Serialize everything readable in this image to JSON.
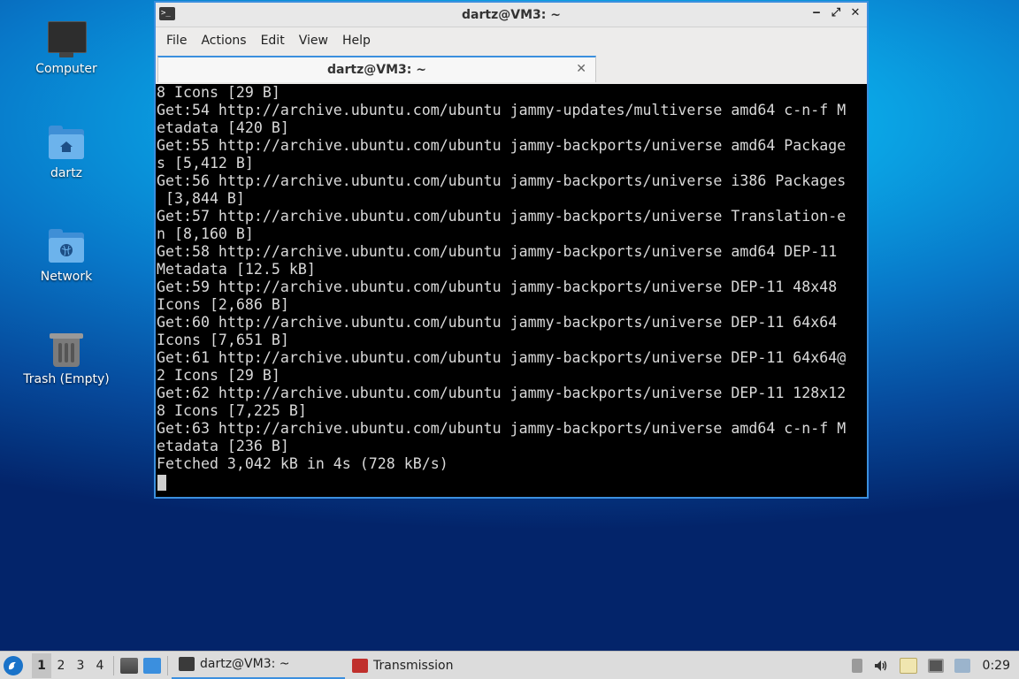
{
  "desktop": {
    "icons": [
      {
        "label": "Computer",
        "icon": "computer-icon"
      },
      {
        "label": "dartz",
        "icon": "home-folder-icon"
      },
      {
        "label": "Network",
        "icon": "network-folder-icon"
      },
      {
        "label": "Trash (Empty)",
        "icon": "trash-icon"
      }
    ]
  },
  "window": {
    "title": "dartz@VM3: ~",
    "controls": {
      "minimize": "‒",
      "maximize": "⤢",
      "close": "✕"
    },
    "menu": [
      "File",
      "Actions",
      "Edit",
      "View",
      "Help"
    ],
    "tab": {
      "label": "dartz@VM3: ~",
      "close": "✕"
    }
  },
  "terminal": {
    "lines": [
      "8 Icons [29 B]",
      "Get:54 http://archive.ubuntu.com/ubuntu jammy-updates/multiverse amd64 c-n-f M",
      "etadata [420 B]",
      "Get:55 http://archive.ubuntu.com/ubuntu jammy-backports/universe amd64 Package",
      "s [5,412 B]",
      "Get:56 http://archive.ubuntu.com/ubuntu jammy-backports/universe i386 Packages",
      " [3,844 B]",
      "Get:57 http://archive.ubuntu.com/ubuntu jammy-backports/universe Translation-e",
      "n [8,160 B]",
      "Get:58 http://archive.ubuntu.com/ubuntu jammy-backports/universe amd64 DEP-11",
      "Metadata [12.5 kB]",
      "Get:59 http://archive.ubuntu.com/ubuntu jammy-backports/universe DEP-11 48x48",
      "Icons [2,686 B]",
      "Get:60 http://archive.ubuntu.com/ubuntu jammy-backports/universe DEP-11 64x64",
      "Icons [7,651 B]",
      "Get:61 http://archive.ubuntu.com/ubuntu jammy-backports/universe DEP-11 64x64@",
      "2 Icons [29 B]",
      "Get:62 http://archive.ubuntu.com/ubuntu jammy-backports/universe DEP-11 128x12",
      "8 Icons [7,225 B]",
      "Get:63 http://archive.ubuntu.com/ubuntu jammy-backports/universe amd64 c-n-f M",
      "etadata [236 B]",
      "Fetched 3,042 kB in 4s (728 kB/s)"
    ]
  },
  "taskbar": {
    "workspaces": [
      "1",
      "2",
      "3",
      "4"
    ],
    "active_workspace": "1",
    "tasks": [
      {
        "label": "dartz@VM3: ~",
        "icon": "terminal-icon",
        "active": true
      },
      {
        "label": "Transmission",
        "icon": "transmission-icon",
        "active": false
      }
    ],
    "clock": "0:29"
  },
  "colors": {
    "accent": "#3b8fde",
    "terminal_bg": "#000000",
    "terminal_fg": "#d9d9d9"
  }
}
